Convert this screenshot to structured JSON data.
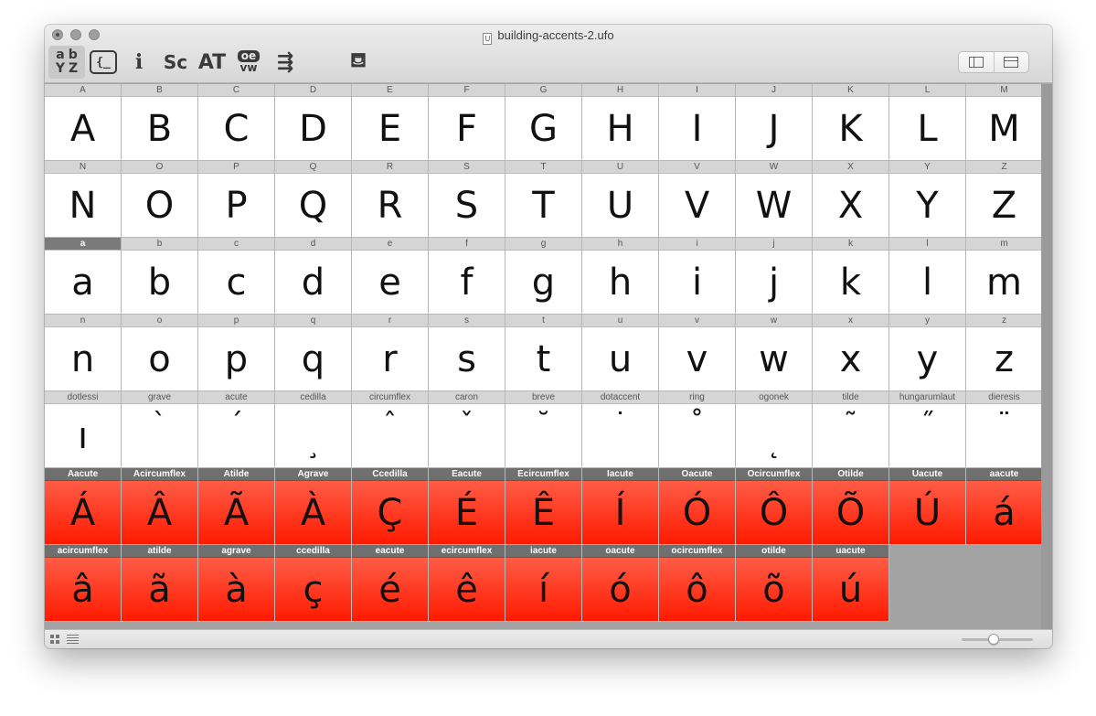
{
  "window": {
    "title": "building-accents-2.ufo",
    "doc_icon_letter": "U"
  },
  "toolbar": {
    "sort_icon": {
      "icon": "sort-az-icon",
      "glyphs": [
        "a",
        "b",
        "Y",
        "Z"
      ]
    },
    "code_icon": {
      "icon": "code-braces-icon",
      "glyph": "{_"
    },
    "info_icon": {
      "icon": "glyph-info-icon",
      "glyph": "i"
    },
    "smallcaps_icon": {
      "icon": "smallcaps-icon",
      "glyph": "Sc"
    },
    "kerning_icon": {
      "icon": "kerning-icon",
      "glyph": "AT"
    },
    "features_icon": {
      "icon": "features-oe-icon",
      "top": "oe",
      "bottom": "vw"
    },
    "wrap_icon": {
      "icon": "text-wrap-icon",
      "glyph": "⇶"
    },
    "bucket_icon": {
      "icon": "paint-bucket-icon",
      "glyph": "⛾"
    }
  },
  "layout_toggle": {
    "left_icon": "sidebar-left-icon",
    "right_icon": "sidebar-top-icon"
  },
  "glyphs": [
    {
      "label": "A",
      "glyph": "A"
    },
    {
      "label": "B",
      "glyph": "B"
    },
    {
      "label": "C",
      "glyph": "C"
    },
    {
      "label": "D",
      "glyph": "D"
    },
    {
      "label": "E",
      "glyph": "E"
    },
    {
      "label": "F",
      "glyph": "F"
    },
    {
      "label": "G",
      "glyph": "G"
    },
    {
      "label": "H",
      "glyph": "H"
    },
    {
      "label": "I",
      "glyph": "I"
    },
    {
      "label": "J",
      "glyph": "J"
    },
    {
      "label": "K",
      "glyph": "K"
    },
    {
      "label": "L",
      "glyph": "L"
    },
    {
      "label": "M",
      "glyph": "M"
    },
    {
      "label": "N",
      "glyph": "N"
    },
    {
      "label": "O",
      "glyph": "O"
    },
    {
      "label": "P",
      "glyph": "P"
    },
    {
      "label": "Q",
      "glyph": "Q"
    },
    {
      "label": "R",
      "glyph": "R"
    },
    {
      "label": "S",
      "glyph": "S"
    },
    {
      "label": "T",
      "glyph": "T"
    },
    {
      "label": "U",
      "glyph": "U"
    },
    {
      "label": "V",
      "glyph": "V"
    },
    {
      "label": "W",
      "glyph": "W"
    },
    {
      "label": "X",
      "glyph": "X"
    },
    {
      "label": "Y",
      "glyph": "Y"
    },
    {
      "label": "Z",
      "glyph": "Z"
    },
    {
      "label": "a",
      "glyph": "a",
      "state": "selected"
    },
    {
      "label": "b",
      "glyph": "b"
    },
    {
      "label": "c",
      "glyph": "c"
    },
    {
      "label": "d",
      "glyph": "d"
    },
    {
      "label": "e",
      "glyph": "e"
    },
    {
      "label": "f",
      "glyph": "f"
    },
    {
      "label": "g",
      "glyph": "g"
    },
    {
      "label": "h",
      "glyph": "h"
    },
    {
      "label": "i",
      "glyph": "i"
    },
    {
      "label": "j",
      "glyph": "j"
    },
    {
      "label": "k",
      "glyph": "k"
    },
    {
      "label": "l",
      "glyph": "l"
    },
    {
      "label": "m",
      "glyph": "m"
    },
    {
      "label": "n",
      "glyph": "n"
    },
    {
      "label": "o",
      "glyph": "o"
    },
    {
      "label": "p",
      "glyph": "p"
    },
    {
      "label": "q",
      "glyph": "q"
    },
    {
      "label": "r",
      "glyph": "r"
    },
    {
      "label": "s",
      "glyph": "s"
    },
    {
      "label": "t",
      "glyph": "t"
    },
    {
      "label": "u",
      "glyph": "u"
    },
    {
      "label": "v",
      "glyph": "v"
    },
    {
      "label": "w",
      "glyph": "w"
    },
    {
      "label": "x",
      "glyph": "x"
    },
    {
      "label": "y",
      "glyph": "y"
    },
    {
      "label": "z",
      "glyph": "z"
    },
    {
      "label": "dotlessi",
      "glyph": "ı"
    },
    {
      "label": "grave",
      "glyph": "`",
      "pos": "mark"
    },
    {
      "label": "acute",
      "glyph": "´",
      "pos": "mark"
    },
    {
      "label": "cedilla",
      "glyph": "¸",
      "pos": "low"
    },
    {
      "label": "circumflex",
      "glyph": "ˆ",
      "pos": "mark"
    },
    {
      "label": "caron",
      "glyph": "ˇ",
      "pos": "mark"
    },
    {
      "label": "breve",
      "glyph": "˘",
      "pos": "mark"
    },
    {
      "label": "dotaccent",
      "glyph": "˙",
      "pos": "mark"
    },
    {
      "label": "ring",
      "glyph": "˚",
      "pos": "mark"
    },
    {
      "label": "ogonek",
      "glyph": "˛",
      "pos": "low"
    },
    {
      "label": "tilde",
      "glyph": "˜",
      "pos": "mark"
    },
    {
      "label": "hungarumlaut",
      "glyph": "˝",
      "pos": "mark"
    },
    {
      "label": "dieresis",
      "glyph": "¨",
      "pos": "mark"
    },
    {
      "label": "Aacute",
      "glyph": "Á",
      "state": "red"
    },
    {
      "label": "Acircumflex",
      "glyph": "Â",
      "state": "red"
    },
    {
      "label": "Atilde",
      "glyph": "Ã",
      "state": "red"
    },
    {
      "label": "Agrave",
      "glyph": "À",
      "state": "red"
    },
    {
      "label": "Ccedilla",
      "glyph": "Ç",
      "state": "red"
    },
    {
      "label": "Eacute",
      "glyph": "É",
      "state": "red"
    },
    {
      "label": "Ecircumflex",
      "glyph": "Ê",
      "state": "red"
    },
    {
      "label": "Iacute",
      "glyph": "Í",
      "state": "red"
    },
    {
      "label": "Oacute",
      "glyph": "Ó",
      "state": "red"
    },
    {
      "label": "Ocircumflex",
      "glyph": "Ô",
      "state": "red"
    },
    {
      "label": "Otilde",
      "glyph": "Õ",
      "state": "red"
    },
    {
      "label": "Uacute",
      "glyph": "Ú",
      "state": "red"
    },
    {
      "label": "aacute",
      "glyph": "á",
      "state": "red"
    },
    {
      "label": "acircumflex",
      "glyph": "â",
      "state": "red"
    },
    {
      "label": "atilde",
      "glyph": "ã",
      "state": "red"
    },
    {
      "label": "agrave",
      "glyph": "à",
      "state": "red"
    },
    {
      "label": "ccedilla",
      "glyph": "ç",
      "state": "red"
    },
    {
      "label": "eacute",
      "glyph": "é",
      "state": "red"
    },
    {
      "label": "ecircumflex",
      "glyph": "ê",
      "state": "red"
    },
    {
      "label": "iacute",
      "glyph": "í",
      "state": "red"
    },
    {
      "label": "oacute",
      "glyph": "ó",
      "state": "red"
    },
    {
      "label": "ocircumflex",
      "glyph": "ô",
      "state": "red"
    },
    {
      "label": "otilde",
      "glyph": "õ",
      "state": "red"
    },
    {
      "label": "uacute",
      "glyph": "ú",
      "state": "red"
    }
  ],
  "bottom_bar": {
    "grid_view_icon": "grid-view-icon",
    "list_view_icon": "list-view-icon",
    "zoom_slider": {
      "icon": "zoom-slider",
      "value": 0.45
    }
  }
}
